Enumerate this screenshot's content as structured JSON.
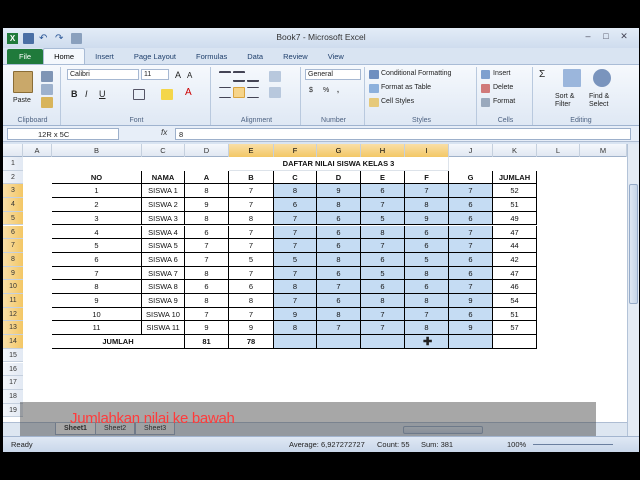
{
  "window": {
    "title": "Book7 - Microsoft Excel"
  },
  "ribbon": {
    "tabs": [
      "File",
      "Home",
      "Insert",
      "Page Layout",
      "Formulas",
      "Data",
      "Review",
      "View"
    ],
    "clipboard": {
      "label": "Clipboard",
      "paste": "Paste"
    },
    "font": {
      "label": "Font",
      "name": "Calibri",
      "size": "11"
    },
    "alignment": {
      "label": "Alignment"
    },
    "number": {
      "label": "Number",
      "format": "General"
    },
    "styles": {
      "label": "Styles",
      "conditional": "Conditional Formatting",
      "format_table": "Format as Table",
      "cell_styles": "Cell Styles"
    },
    "cells": {
      "label": "Cells",
      "insert": "Insert",
      "delete": "Delete",
      "format": "Format"
    },
    "editing": {
      "label": "Editing",
      "sort": "Sort & Filter",
      "find": "Find & Select"
    }
  },
  "formula_bar": {
    "name_box": "12R x 5C",
    "fx": "fx",
    "value": "8"
  },
  "columns": [
    "A",
    "B",
    "C",
    "D",
    "E",
    "F",
    "G",
    "H",
    "I",
    "J",
    "K",
    "L",
    "M"
  ],
  "rows": [
    "1",
    "2",
    "3",
    "4",
    "5",
    "6",
    "7",
    "8",
    "9",
    "10",
    "11",
    "12",
    "13",
    "14",
    "15",
    "16",
    "17",
    "18",
    "19"
  ],
  "sheet": {
    "title": "DAFTAR NILAI SISWA KELAS 3",
    "headers": [
      "NO",
      "NAMA",
      "A",
      "B",
      "C",
      "D",
      "E",
      "F",
      "G",
      "JUMLAH"
    ],
    "data": [
      [
        "1",
        "SISWA 1",
        "8",
        "7",
        "8",
        "9",
        "6",
        "7",
        "7",
        "52"
      ],
      [
        "2",
        "SISWA 2",
        "9",
        "7",
        "6",
        "8",
        "7",
        "8",
        "6",
        "51"
      ],
      [
        "3",
        "SISWA 3",
        "8",
        "8",
        "7",
        "6",
        "5",
        "9",
        "6",
        "49"
      ],
      [
        "4",
        "SISWA 4",
        "6",
        "7",
        "7",
        "6",
        "8",
        "6",
        "7",
        "47"
      ],
      [
        "5",
        "SISWA 5",
        "7",
        "7",
        "7",
        "6",
        "7",
        "6",
        "7",
        "44"
      ],
      [
        "6",
        "SISWA 6",
        "7",
        "5",
        "5",
        "8",
        "6",
        "5",
        "6",
        "42"
      ],
      [
        "7",
        "SISWA 7",
        "8",
        "7",
        "7",
        "6",
        "5",
        "8",
        "6",
        "47"
      ],
      [
        "8",
        "SISWA 8",
        "6",
        "6",
        "8",
        "7",
        "6",
        "6",
        "7",
        "46"
      ],
      [
        "9",
        "SISWA 9",
        "8",
        "8",
        "7",
        "6",
        "8",
        "8",
        "9",
        "54"
      ],
      [
        "10",
        "SISWA 10",
        "7",
        "7",
        "9",
        "8",
        "7",
        "7",
        "6",
        "51"
      ],
      [
        "11",
        "SISWA 11",
        "9",
        "9",
        "8",
        "7",
        "7",
        "8",
        "9",
        "57"
      ]
    ],
    "total_label": "JUMLAH",
    "total_a": "81",
    "total_b": "78"
  },
  "sheet_tabs": [
    "Sheet1",
    "Sheet2",
    "Sheet3"
  ],
  "status": {
    "mode": "Ready",
    "average": "Average: 6,927272727",
    "count": "Count: 55",
    "sum": "Sum: 381",
    "zoom": "100%"
  },
  "caption": "Jumlahkan nilai ke bawah"
}
